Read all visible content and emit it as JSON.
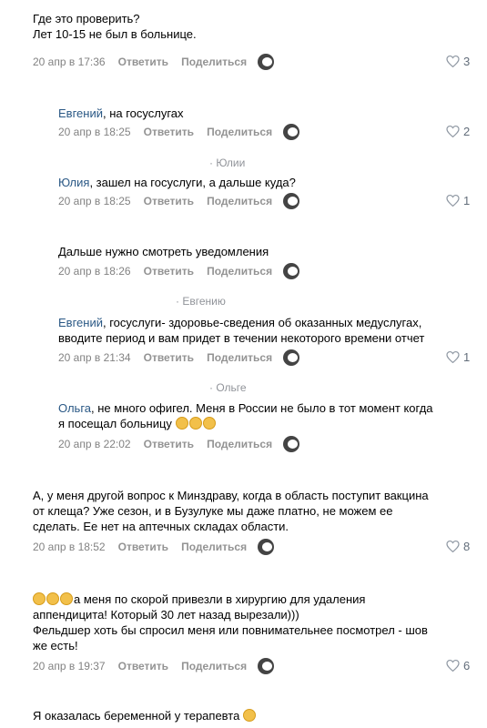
{
  "comments": [
    {
      "lines": [
        "Где это проверить?",
        "Лет 10-15 не был в больнице."
      ],
      "date": "20 апр в 17:36",
      "reply": "Ответить",
      "share": "Поделиться",
      "likes": "3"
    },
    {
      "name": "Евгений",
      "lines": [
        ", на госуслугах"
      ],
      "date": "20 апр в 18:25",
      "reply": "Ответить",
      "share": "Поделиться",
      "likes": "2"
    },
    {
      "reply_to": "· Юлии",
      "name": "Юлия",
      "lines": [
        ", зашел на госуслуги, а дальше куда?"
      ],
      "date": "20 апр в 18:25",
      "reply": "Ответить",
      "share": "Поделиться",
      "likes": "1"
    },
    {
      "lines": [
        "Дальше нужно смотреть уведомления"
      ],
      "date": "20 апр в 18:26",
      "reply": "Ответить",
      "share": "Поделиться"
    },
    {
      "reply_to": "· Евгению",
      "name": "Евгений",
      "lines": [
        ", госуслуги- здоровье-сведения об оказанных медуслугах,",
        "вводите период и вам придет в течении некоторого времени отчет"
      ],
      "date": "20 апр в 21:34",
      "reply": "Ответить",
      "share": "Поделиться",
      "likes": "1"
    },
    {
      "reply_to": "· Ольге",
      "name": "Ольга",
      "lines": [
        ", не много офигел. Меня в России не было в тот момент когда",
        "я посещал больницу"
      ],
      "date": "20 апр в 22:02",
      "reply": "Ответить",
      "share": "Поделиться"
    },
    {
      "lines": [
        "А, у меня другой вопрос к Минздраву, когда в область поступит вакцина",
        "от клеща? Уже сезон, и в Бузулуке мы даже платно, не можем ее",
        "сделать. Ее нет на аптечных складах области."
      ],
      "date": "20 апр в 18:52",
      "reply": "Ответить",
      "share": "Поделиться",
      "likes": "8"
    },
    {
      "lines": [
        "а меня по скорой привезли в хирургию для удаления",
        "аппендицита! Который 30 лет назад вырезали)))",
        "Фельдшер хоть бы спросил меня или повнимательнее посмотрел - шов",
        "же есть!"
      ],
      "date": "20 апр в 19:37",
      "reply": "Ответить",
      "share": "Поделиться",
      "likes": "6"
    },
    {
      "lines": [
        "Я оказалась беременной у терапевта"
      ]
    }
  ],
  "colors": {
    "link": "#2a5885",
    "meta": "#828282",
    "action": "#939393"
  }
}
